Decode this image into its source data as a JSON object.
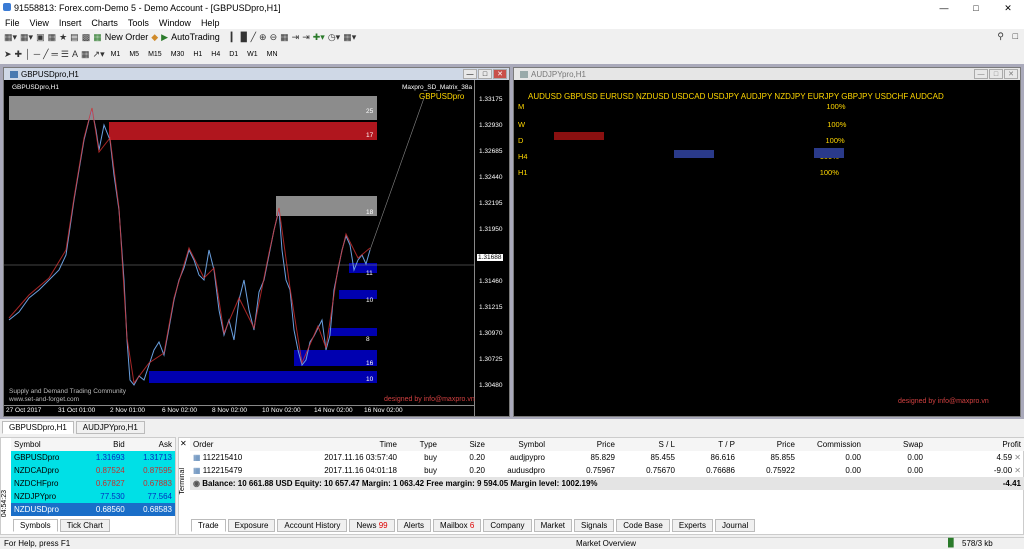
{
  "window": {
    "title": "91558813: Forex.com-Demo 5 - Demo Account - [GBPUSDpro,H1]"
  },
  "menu": [
    "File",
    "View",
    "Insert",
    "Charts",
    "Tools",
    "Window",
    "Help"
  ],
  "toolbar": {
    "new_order": "New Order",
    "autotrading": "AutoTrading",
    "timeframes": [
      "M1",
      "M5",
      "M15",
      "M30",
      "H1",
      "H4",
      "D1",
      "W1",
      "MN"
    ]
  },
  "chart1": {
    "tab": "GBPUSDpro,H1",
    "symbol_label": "GBPUSDpro,H1",
    "indicator": "Maxpro_SD_Matrix_38a",
    "indicator_symbol": "GBPUSDpro",
    "prices": [
      "1.33175",
      "1.32930",
      "1.32685",
      "1.32440",
      "1.32195",
      "1.31950",
      "1.31688",
      "1.31460",
      "1.31215",
      "1.30970",
      "1.30725",
      "1.30480"
    ],
    "dates": [
      "27 Oct 2017",
      "31 Oct 01:00",
      "2 Nov 01:00",
      "6 Nov 02:00",
      "8 Nov 02:00",
      "10 Nov 02:00",
      "14 Nov 02:00",
      "16 Nov 02:00"
    ],
    "zone_labels": [
      "25",
      "17",
      "18",
      "11",
      "10",
      "8",
      "16",
      "10"
    ],
    "footer": "designed by info@maxpro.vn",
    "community": "Supply and Demand Trading Community",
    "community_url": "www.set-and-forget.com"
  },
  "chart2": {
    "tab": "AUDJPYpro,H1",
    "title": "AUDJPYpro,H1",
    "header_row": "AUDUSD GBPUSD EURUSD NZDUSD USDCAD USDJPY AUDJPY NZDJPY EURJPY GBPJPY USDCHF AUDCAD",
    "row_labels": [
      "M",
      "W",
      "D",
      "H4",
      "H1"
    ],
    "cell": "100%",
    "footer": "designed by info@maxpro.vn"
  },
  "tabs_bottom": [
    "GBPUSDpro,H1",
    "AUDJPYpro,H1"
  ],
  "market_watch": {
    "headers": [
      "Symbol",
      "Bid",
      "Ask"
    ],
    "rows": [
      [
        "GBPUSDpro",
        "1.31693",
        "1.31713"
      ],
      [
        "NZDCADpro",
        "0.87524",
        "0.87595"
      ],
      [
        "NZDCHFpro",
        "0.67827",
        "0.67883"
      ],
      [
        "NZDJPYpro",
        "77.530",
        "77.564"
      ],
      [
        "NZDUSDpro",
        "0.68560",
        "0.68583"
      ]
    ],
    "time": "04:54:23",
    "tabs": [
      "Symbols",
      "Tick Chart"
    ]
  },
  "terminal": {
    "label": "Terminal",
    "headers": [
      "Order",
      "Time",
      "Type",
      "Size",
      "Symbol",
      "Price",
      "S / L",
      "T / P",
      "Price",
      "Commission",
      "Swap",
      "Profit"
    ],
    "rows": [
      [
        "112215410",
        "2017.11.16 03:57:40",
        "buy",
        "0.20",
        "audjpypro",
        "85.829",
        "85.455",
        "86.616",
        "85.855",
        "0.00",
        "0.00",
        "4.59"
      ],
      [
        "112215479",
        "2017.11.16 04:01:18",
        "buy",
        "0.20",
        "audusdpro",
        "0.75967",
        "0.75670",
        "0.76686",
        "0.75922",
        "0.00",
        "0.00",
        "-9.00"
      ]
    ],
    "balance": "Balance: 10 661.88 USD  Equity: 10 657.47  Margin: 1 063.42  Free margin: 9 594.05  Margin level: 1002.19%",
    "total": "-4.41",
    "tabs": [
      "Trade",
      "Exposure",
      "Account History",
      "News",
      "Alerts",
      "Mailbox",
      "Company",
      "Market",
      "Signals",
      "Code Base",
      "Experts",
      "Journal"
    ],
    "news_count": "99",
    "mailbox_count": "6"
  },
  "status": {
    "help": "For Help, press F1",
    "profile": "Market Overview",
    "traffic": "578/3 kb"
  }
}
